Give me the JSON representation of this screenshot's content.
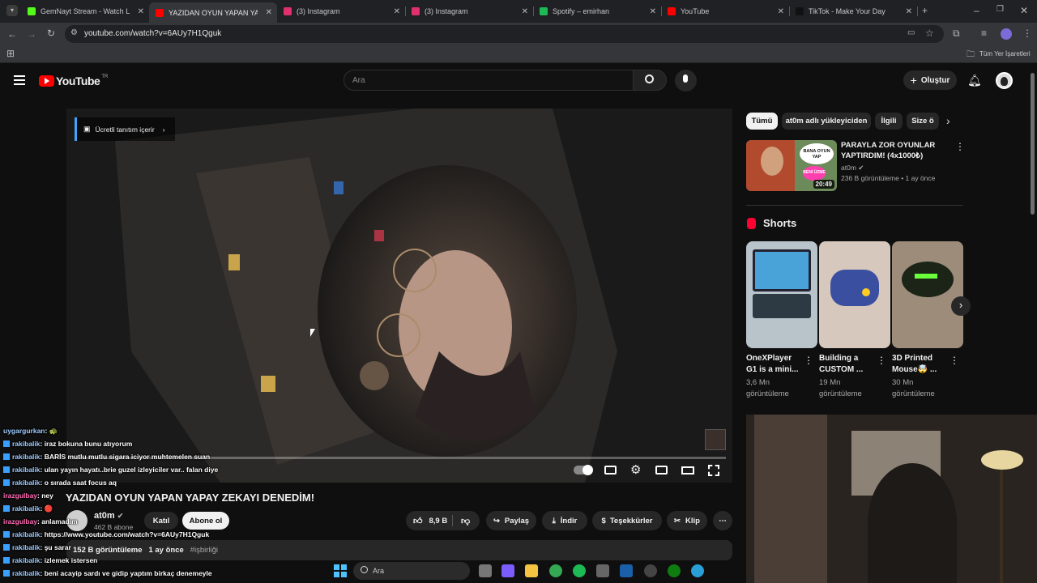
{
  "browser": {
    "tabs": [
      {
        "title": "GemNayt Stream - Watch Live o",
        "color": "#53fc18"
      },
      {
        "title": "YAZIDAN OYUN YAPAN YA",
        "color": "#ff0000"
      },
      {
        "title": "(3) Instagram",
        "color": "#e1306c"
      },
      {
        "title": "(3) Instagram",
        "color": "#e1306c"
      },
      {
        "title": "Spotify – emirhan",
        "color": "#1db954"
      },
      {
        "title": "YouTube",
        "color": "#ff0000"
      },
      {
        "title": "TikTok - Make Your Day",
        "color": "#111111"
      }
    ],
    "url": "youtube.com/watch?v=6AUy7H1Qguk",
    "bookmarks_label": "Tüm Yer İşaretleri"
  },
  "yt": {
    "logo": "YouTube",
    "region": "TR",
    "search_placeholder": "Ara",
    "create_label": "Oluştur"
  },
  "video": {
    "promo_label": "Ücretli tanıtım içerir",
    "title": "YAZIDAN OYUN YAPAN YAPAY ZEKAYI DENEDİM!",
    "channel": "at0m",
    "subscribers": "462 B abone",
    "join_label": "Katıl",
    "subscribe_label": "Abone ol",
    "likes": "8,9 B",
    "share_label": "Paylaş",
    "download_label": "İndir",
    "thanks_label": "Teşekkürler",
    "clip_label": "Klip",
    "views": "152 B görüntüleme",
    "age": "1 ay önce",
    "tag": "#işbirliği"
  },
  "sidebar": {
    "chips": [
      "Tümü",
      "at0m adlı yükleyiciden",
      "İlgili",
      "Size ö"
    ],
    "recommended": {
      "title": "PARAYLA ZOR OYUNLAR YAPTIRDIM! (4x1000₺)",
      "channel": "at0m",
      "meta": "236 B görüntüleme • 1 ay önce",
      "duration": "20:49",
      "thumb_text_1": "BANA OYUN YAP",
      "thumb_text_2": "BENİ ÜZME"
    },
    "shorts_heading": "Shorts",
    "shorts": [
      {
        "title": "OneXPlayer G1 is a mini...",
        "views": "3,6 Mn",
        "unit": "görüntüleme",
        "color": "#8aa0b4"
      },
      {
        "title": "Building a CUSTOM ...",
        "views": "19 Mn",
        "unit": "görüntüleme",
        "color": "#3a4fa0"
      },
      {
        "title": "3D Printed Mouse🤯 ...",
        "views": "30 Mn",
        "unit": "görüntüleme",
        "color": "#1c2418"
      }
    ]
  },
  "chat": [
    {
      "user": "uygargurkan",
      "msg": ": 🐢",
      "pink": false
    },
    {
      "user": "rakibalik",
      "msg": ": iraz bokuna bunu atıyorum",
      "pink": false
    },
    {
      "user": "rakibalik",
      "msg": ": BARİS mutlu mutlu sigara iciyor muhtemelen suan",
      "pink": false
    },
    {
      "user": "rakibalik",
      "msg": ": ulan yayın hayatı..brie guzel izleyiciler var..  falan diye",
      "pink": false
    },
    {
      "user": "rakibalik",
      "msg": ": o sırada saat focus aq",
      "pink": false
    },
    {
      "user": "irazgulbay",
      "msg": ": ney",
      "pink": true
    },
    {
      "user": "rakibalik",
      "msg": ": 🔴",
      "pink": false
    },
    {
      "user": "irazgulbay",
      "msg": ": anlamadım",
      "pink": true
    },
    {
      "user": "rakibalik",
      "msg": ": https://www.youtube.com/watch?v=6AUy7H1Qguk",
      "pink": false
    },
    {
      "user": "rakibalik",
      "msg": ": şu sarar",
      "pink": false
    },
    {
      "user": "rakibalik",
      "msg": ": izlemek istersen",
      "pink": false
    },
    {
      "user": "rakibalik",
      "msg": ": beni acayip sardı ve gidip yaptım birkaç denemeyle",
      "pink": false
    }
  ],
  "taskbar": {
    "search_placeholder": "Ara"
  }
}
